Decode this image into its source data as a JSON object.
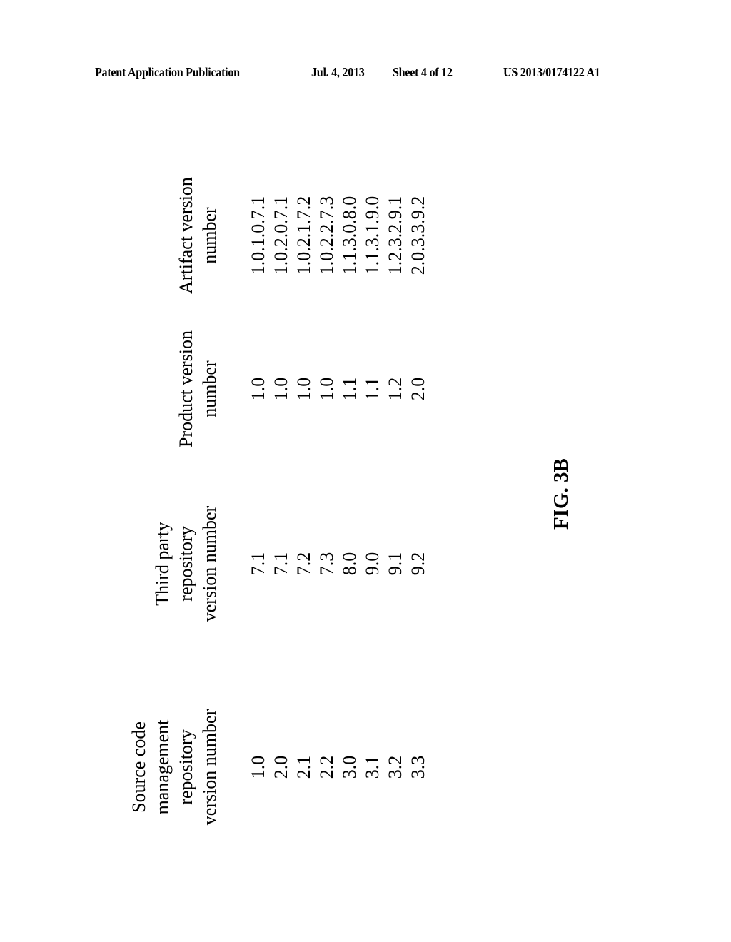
{
  "header": {
    "publication": "Patent Application Publication",
    "date": "Jul. 4, 2013",
    "sheet": "Sheet 4 of 12",
    "number": "US 2013/0174122 A1"
  },
  "table": {
    "columns": [
      {
        "header_lines": [
          "Source code",
          "management repository",
          "version number"
        ],
        "values": [
          "1.0",
          "2.0",
          "2.1",
          "2.2",
          "3.0",
          "3.1",
          "3.2",
          "3.3"
        ]
      },
      {
        "header_lines": [
          "Third party",
          "repository",
          "version number"
        ],
        "values": [
          "7.1",
          "7.1",
          "7.2",
          "7.3",
          "8.0",
          "9.0",
          "9.1",
          "9.2"
        ]
      },
      {
        "header_lines": [
          "Product version",
          "number"
        ],
        "values": [
          "1.0",
          "1.0",
          "1.0",
          "1.0",
          "1.1",
          "1.1",
          "1.2",
          "2.0"
        ]
      },
      {
        "header_lines": [
          "Artifact version",
          "number"
        ],
        "values": [
          "1.0.1.0.7.1",
          "1.0.2.0.7.1",
          "1.0.2.1.7.2",
          "1.0.2.2.7.3",
          "1.1.3.0.8.0",
          "1.1.3.1.9.0",
          "1.2.3.2.9.1",
          "2.0.3.3.9.2"
        ]
      }
    ]
  },
  "figure_label": "FIG. 3B"
}
